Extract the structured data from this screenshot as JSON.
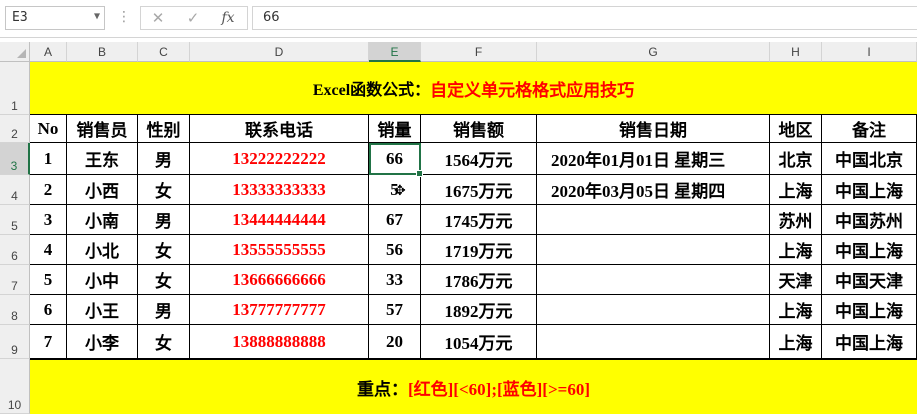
{
  "formula_bar": {
    "name_box": "E3",
    "cancel_icon": "✕",
    "enter_icon": "✓",
    "fx_label": "fx",
    "formula_value": "66"
  },
  "columns": [
    "A",
    "B",
    "C",
    "D",
    "E",
    "F",
    "G",
    "H",
    "I"
  ],
  "rows": [
    "1",
    "2",
    "3",
    "4",
    "5",
    "6",
    "7",
    "8",
    "9",
    "10"
  ],
  "title": {
    "prefix": "Excel函数公式：",
    "highlight": "自定义单元格格式应用技巧"
  },
  "headers": [
    "No",
    "销售员",
    "性别",
    "联系电话",
    "销量",
    "销售额",
    "销售日期",
    "地区",
    "备注"
  ],
  "records": [
    {
      "no": "1",
      "name": "王东",
      "gender": "男",
      "phone": "13222222222",
      "qty": "66",
      "amount": "1564万元",
      "date": "2020年01月01日  星期三",
      "region": "北京",
      "note": "中国北京"
    },
    {
      "no": "2",
      "name": "小西",
      "gender": "女",
      "phone": "13333333333",
      "qty": "5",
      "amount": "1675万元",
      "date": "2020年03月05日  星期四",
      "region": "上海",
      "note": "中国上海"
    },
    {
      "no": "3",
      "name": "小南",
      "gender": "男",
      "phone": "13444444444",
      "qty": "67",
      "amount": "1745万元",
      "date": "",
      "region": "苏州",
      "note": "中国苏州"
    },
    {
      "no": "4",
      "name": "小北",
      "gender": "女",
      "phone": "13555555555",
      "qty": "56",
      "amount": "1719万元",
      "date": "",
      "region": "上海",
      "note": "中国上海"
    },
    {
      "no": "5",
      "name": "小中",
      "gender": "女",
      "phone": "13666666666",
      "qty": "33",
      "amount": "1786万元",
      "date": "",
      "region": "天津",
      "note": "中国天津"
    },
    {
      "no": "6",
      "name": "小王",
      "gender": "男",
      "phone": "13777777777",
      "qty": "57",
      "amount": "1892万元",
      "date": "",
      "region": "上海",
      "note": "中国上海"
    },
    {
      "no": "7",
      "name": "小李",
      "gender": "女",
      "phone": "13888888888",
      "qty": "20",
      "amount": "1054万元",
      "date": "",
      "region": "上海",
      "note": "中国上海"
    }
  ],
  "footer": {
    "prefix": "重点：",
    "highlight": "[红色][<60];[蓝色][>=60]"
  },
  "active_cell": "E3",
  "colors": {
    "highlight_fill": "#ffff00",
    "emphasis_text": "#ff0000",
    "selection": "#217346"
  }
}
